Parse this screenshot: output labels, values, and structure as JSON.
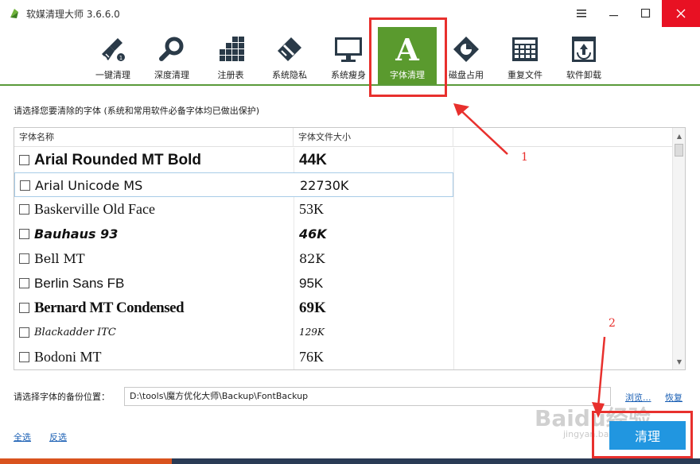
{
  "window": {
    "title": "软媒清理大师 3.6.6.0",
    "menu_icon": "hamburger-icon",
    "minimize_icon": "minimize-icon",
    "maximize_icon": "maximize-icon",
    "close_icon": "close-icon"
  },
  "toolbar": {
    "items": [
      {
        "label": "一键清理",
        "icon": "broom-icon"
      },
      {
        "label": "深度清理",
        "icon": "magnifier-icon"
      },
      {
        "label": "注册表",
        "icon": "registry-blocks-icon"
      },
      {
        "label": "系统隐私",
        "icon": "privacy-eraser-icon"
      },
      {
        "label": "系统瘦身",
        "icon": "monitor-icon"
      },
      {
        "label": "字体清理",
        "icon": "font-a-icon"
      },
      {
        "label": "磁盘占用",
        "icon": "disk-pie-icon"
      },
      {
        "label": "重复文件",
        "icon": "duplicate-grid-icon"
      },
      {
        "label": "软件卸载",
        "icon": "recycle-bin-icon"
      }
    ],
    "active_index": 5,
    "accent_color": "#5a9a2e"
  },
  "annotations": {
    "marker_1": "1",
    "marker_2": "2",
    "color": "#e8302d"
  },
  "main": {
    "hint": "请选择您要清除的字体 (系统和常用软件必备字体均已做出保护)",
    "columns": [
      "字体名称",
      "字体文件大小"
    ],
    "rows": [
      {
        "name": "Arial Rounded MT Bold",
        "size": "44K"
      },
      {
        "name": "Arial Unicode MS",
        "size": "22730K"
      },
      {
        "name": "Baskerville Old Face",
        "size": "53K"
      },
      {
        "name": "Bauhaus 93",
        "size": "46K"
      },
      {
        "name": "Bell MT",
        "size": "82K"
      },
      {
        "name": "Berlin Sans FB",
        "size": "95K"
      },
      {
        "name": "Bernard MT Condensed",
        "size": "69K"
      },
      {
        "name": "Blackadder ITC",
        "size": "129K"
      },
      {
        "name": "Bodoni MT",
        "size": "76K"
      }
    ],
    "selected_row": 1
  },
  "backup": {
    "label": "请选择字体的备份位置：",
    "path": "D:\\tools\\魔方优化大师\\Backup\\FontBackup",
    "browse": "浏览...",
    "restore": "恢复"
  },
  "footer": {
    "select_all": "全选",
    "invert": "反选",
    "clean_button": "清理"
  },
  "watermark": {
    "main": "Baidu经验",
    "sub": "jingyan.baidu.com"
  }
}
